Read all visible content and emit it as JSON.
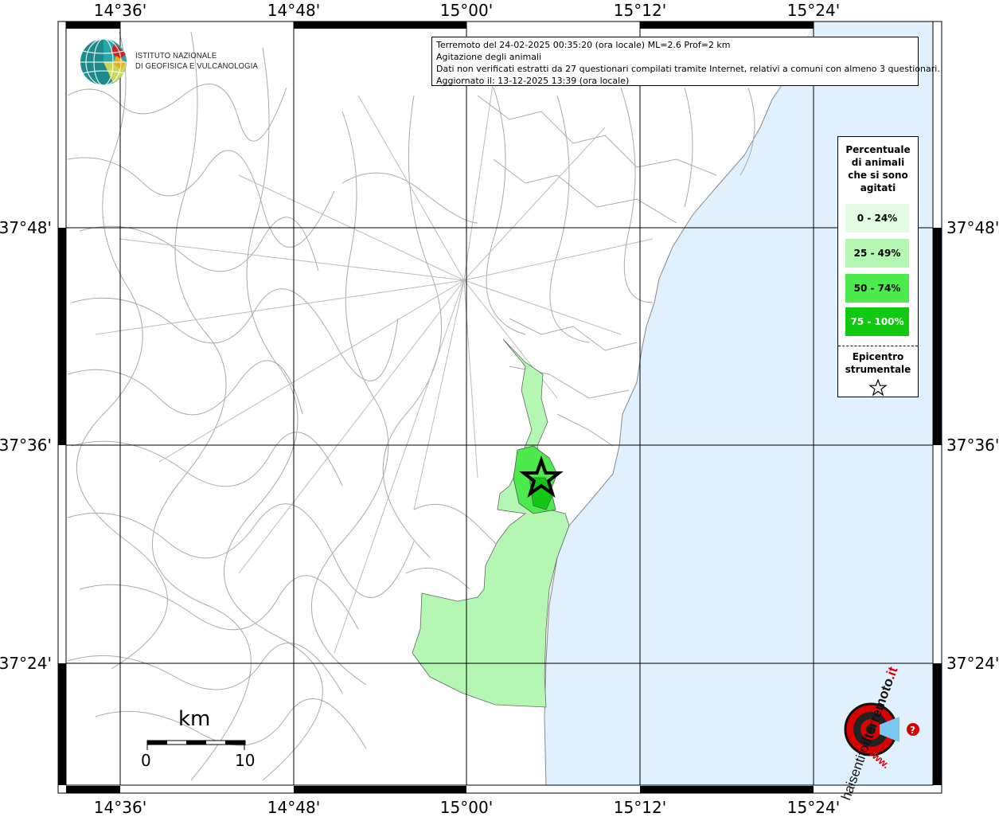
{
  "info": {
    "line1": "Terremoto del 24-02-2025 00:35:20 (ora locale) ML=2.6 Prof=2 km",
    "line2": "Agitazione degli animali",
    "line3": "Dati non verificati estratti da 27 questionari compilati tramite Internet, relativi a comuni con almeno 3 questionari.",
    "line4": "Aggiornato il: 13-12-2025 13:39 (ora locale)"
  },
  "institute": {
    "line1": "ISTITUTO NAZIONALE",
    "line2": "DI GEOFISICA E VULCANOLOGIA"
  },
  "longitude_labels": [
    "14°36'",
    "14°48'",
    "15°00'",
    "15°12'",
    "15°24'"
  ],
  "latitude_labels": [
    "37°48'",
    "37°36'",
    "37°24'"
  ],
  "legend": {
    "title_lines": [
      "Percentuale",
      "di animali",
      "che si sono",
      "agitati"
    ],
    "classes": [
      {
        "label": "0 - 24%",
        "color": "#e2fbe2",
        "text_color": "#000000"
      },
      {
        "label": "25 - 49%",
        "color": "#b3f7b3",
        "text_color": "#000000"
      },
      {
        "label": "50 - 74%",
        "color": "#4dea4d",
        "text_color": "#000000"
      },
      {
        "label": "75 - 100%",
        "color": "#11c911",
        "text_color": "#ffffff"
      }
    ],
    "epicenter_lines": [
      "Epicentro",
      "strumentale"
    ]
  },
  "scale": {
    "unit": "km",
    "min": "0",
    "max": "10"
  },
  "colors": {
    "sea": "#e0f1fd",
    "border": "#aaaaaa"
  },
  "haisentito": {
    "text1": "haisentito",
    "text2": "ilterremoto",
    "text3": ".it",
    "text4": "www."
  }
}
